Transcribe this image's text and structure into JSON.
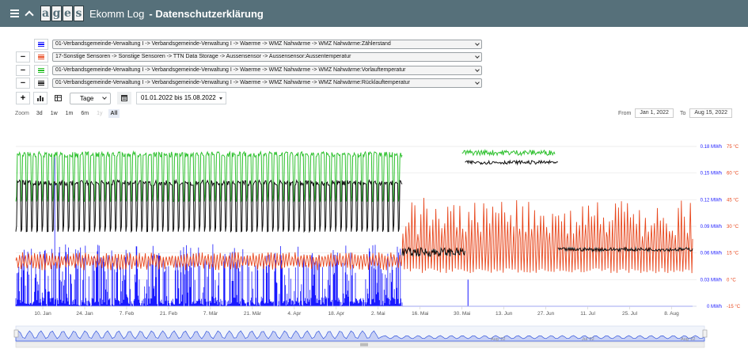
{
  "topbar": {
    "app_title": "Ekomm Log",
    "page_title": "- Datenschutzerklärung",
    "logo_letters": [
      "a",
      "g",
      "e",
      "s"
    ]
  },
  "series_selectors": [
    {
      "sign": "",
      "color": "#1a1aff",
      "value": "01-Verbandsgemeinde-Verwaltung I -> Verbandsgemeinde-Verwaltung I -> Waerme -> WMZ Nahwärme -> WMZ Nahwärme:Zählerstand"
    },
    {
      "sign": "−",
      "color": "#e8481e",
      "value": "17-Sonstige Sensoren -> Sonstige Sensoren -> TTN Data Storage -> Aussensensor -> Aussensensor:Aussentemperatur"
    },
    {
      "sign": "−",
      "color": "#2fc12f",
      "value": "01-Verbandsgemeinde-Verwaltung I -> Verbandsgemeinde-Verwaltung I -> Waerme -> WMZ Nahwärme -> WMZ Nahwärme:Vorlauftemperatur"
    },
    {
      "sign": "−",
      "color": "#111111",
      "value": "01-Verbandsgemeinde-Verwaltung I -> Verbandsgemeinde-Verwaltung I -> Waerme -> WMZ Nahwärme -> WMZ Nahwärme:Rücklauftemperatur"
    }
  ],
  "toolbar": {
    "add": "+",
    "interval": "Tage",
    "date_range": "01.01.2022 bis 15.08.2022"
  },
  "zoom": {
    "label": "Zoom",
    "buttons": [
      "3d",
      "1w",
      "1m",
      "6m",
      "1y",
      "All"
    ],
    "disabled": [
      "1y"
    ],
    "selected": "All"
  },
  "range": {
    "from_label": "From",
    "from": "Jan 1, 2022",
    "to_label": "To",
    "to": "Aug 15, 2022"
  },
  "chart_data": {
    "type": "line",
    "x_range": [
      "2022-01-01",
      "2022-08-15"
    ],
    "x_ticks": [
      "10. Jan",
      "24. Jan",
      "7. Feb",
      "21. Feb",
      "7. Mär",
      "21. Mär",
      "4. Apr",
      "18. Apr",
      "2. Mai",
      "16. Mai",
      "30. Mai",
      "13. Jun",
      "27. Jun",
      "11. Jul",
      "25. Jul",
      "8. Aug"
    ],
    "y_axis_energy": {
      "ticks": [
        "0 MWh",
        "0.03 MWh",
        "0.06 MWh",
        "0.09 MWh",
        "0.12 MWh",
        "0.15 MWh",
        "0.18 MWh"
      ],
      "range": [
        0,
        0.18
      ],
      "color": "#1a1aff"
    },
    "y_axis_temperature": {
      "ticks": [
        "-15 °C",
        "0 °C",
        "15 °C",
        "30 °C",
        "45 °C",
        "60 °C",
        "75 °C"
      ],
      "range": [
        -15,
        75
      ],
      "color": "#e8481e"
    },
    "series": [
      {
        "color": "#2fc12f",
        "axis": "temperature",
        "segments": [
          {
            "from": "2022-01-01",
            "to": "2022-05-10",
            "low": 44,
            "high": 72
          },
          {
            "from": "2022-05-30",
            "to": "2022-06-30",
            "low": 70,
            "high": 73
          }
        ]
      },
      {
        "color": "#111111",
        "axis": "temperature",
        "segments": [
          {
            "from": "2022-01-01",
            "to": "2022-05-10",
            "low": 27,
            "high": 56
          },
          {
            "from": "2022-05-10",
            "to": "2022-05-31",
            "low": 13,
            "high": 18
          },
          {
            "from": "2022-05-31",
            "to": "2022-07-01",
            "low": 65,
            "high": 67
          },
          {
            "from": "2022-07-01",
            "to": "2022-08-15",
            "low": 16,
            "high": 18
          }
        ]
      },
      {
        "color": "#e8481e",
        "axis": "temperature",
        "range_before_may": [
          2,
          18
        ],
        "range_after_may": [
          5,
          45
        ]
      },
      {
        "color": "#1a1aff",
        "axis": "energy",
        "range_before_may": [
          0,
          0.07
        ],
        "after_may": 0
      }
    ],
    "navigator_labels": [
      "Aug '22",
      "Jul '22",
      "Aug '22"
    ]
  }
}
